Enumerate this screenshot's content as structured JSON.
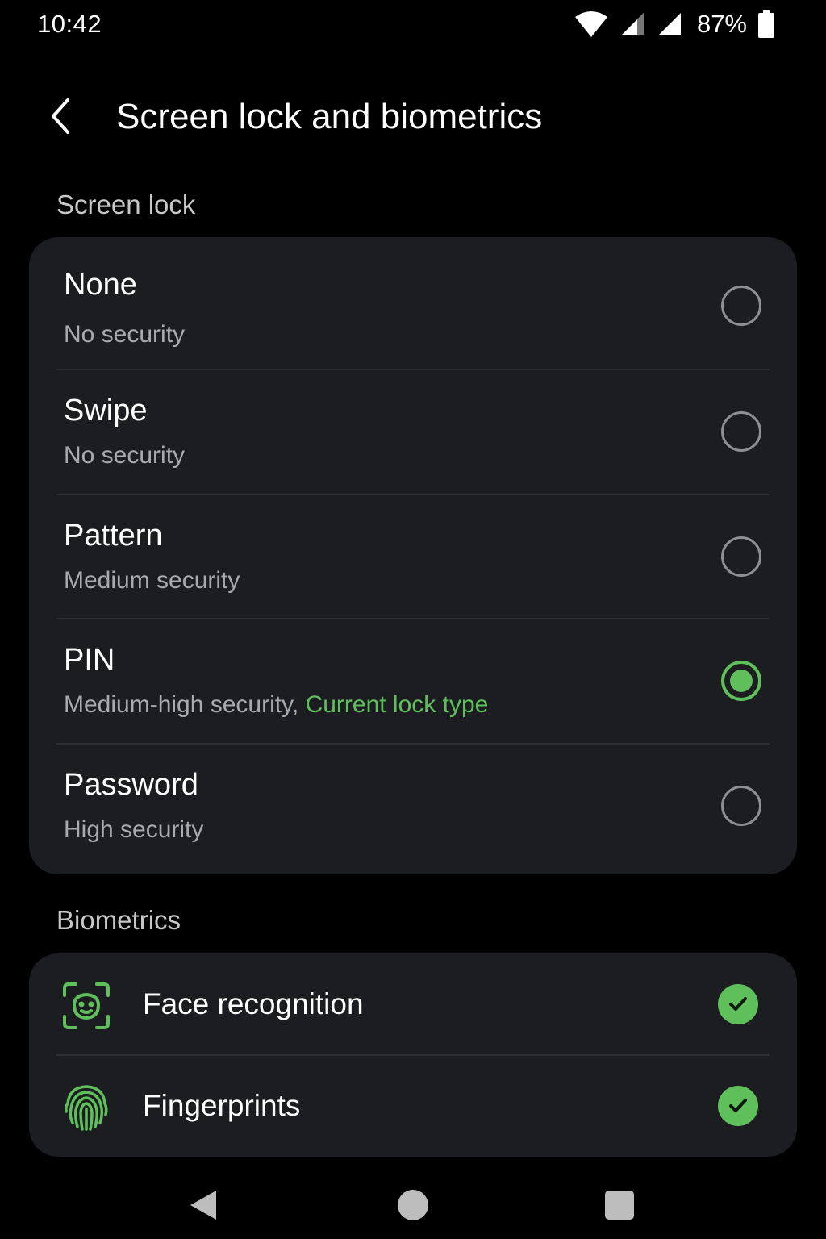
{
  "status_bar": {
    "time": "10:42",
    "battery_percent": "87%",
    "icons": [
      "wifi-icon",
      "signal-icon",
      "signal-icon",
      "battery-icon"
    ]
  },
  "header": {
    "back_icon": "chevron-left-icon",
    "title": "Screen lock and biometrics"
  },
  "screen_lock": {
    "section_label": "Screen lock",
    "options": [
      {
        "title": "None",
        "subtitle": "No security",
        "selected": false
      },
      {
        "title": "Swipe",
        "subtitle": "No security",
        "selected": false
      },
      {
        "title": "Pattern",
        "subtitle": "Medium security",
        "selected": false
      },
      {
        "title": "PIN",
        "subtitle": "Medium-high security,",
        "current_label": "Current lock type",
        "selected": true
      },
      {
        "title": "Password",
        "subtitle": "High security",
        "selected": false
      }
    ]
  },
  "biometrics": {
    "section_label": "Biometrics",
    "items": [
      {
        "label": "Face recognition",
        "icon": "face-scan-icon",
        "enabled": true
      },
      {
        "label": "Fingerprints",
        "icon": "fingerprint-icon",
        "enabled": true
      }
    ]
  },
  "nav_bar": {
    "icons": [
      "back-triangle-icon",
      "home-circle-icon",
      "recents-square-icon"
    ]
  },
  "colors": {
    "accent": "#5fc05b",
    "card_background": "#1b1d20",
    "page_background": "#000000",
    "secondary_text": "#a8aaad"
  }
}
